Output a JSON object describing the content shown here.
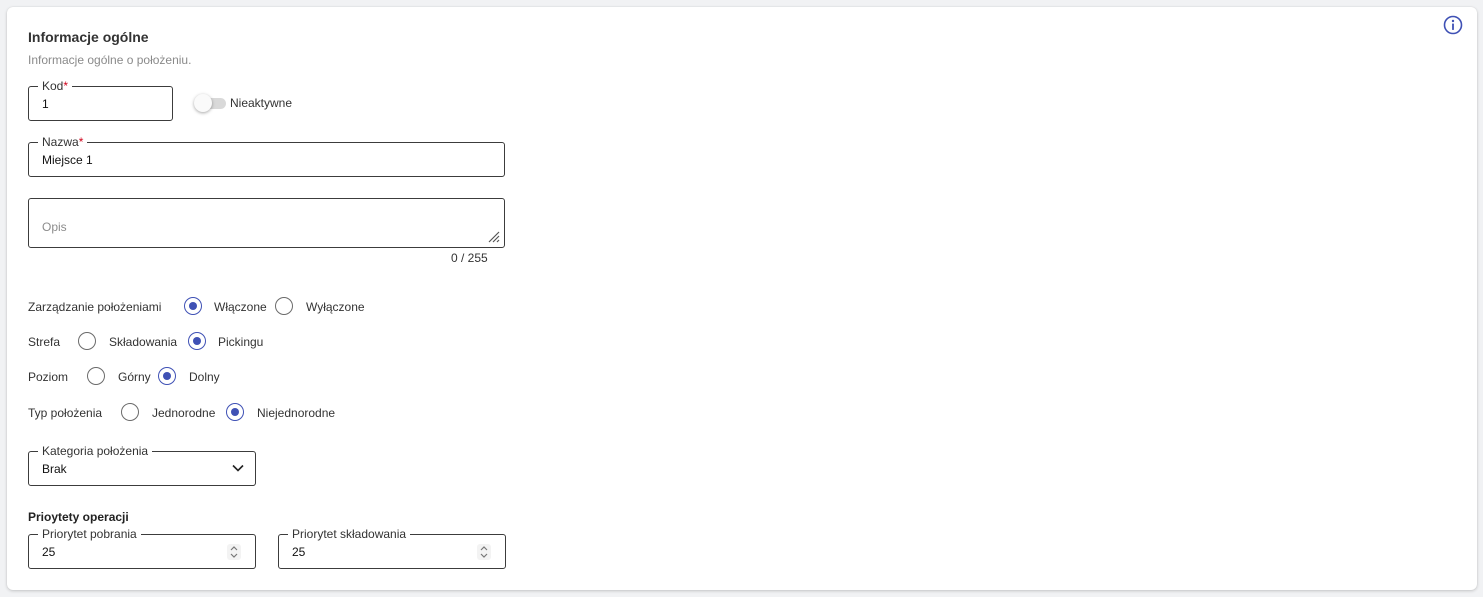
{
  "section": {
    "title": "Informacje ogólne",
    "subtitle": "Informacje ogólne o położeniu."
  },
  "fields": {
    "kod": {
      "label": "Kod",
      "required_mark": "*",
      "value": "1"
    },
    "nazwa": {
      "label": "Nazwa",
      "required_mark": "*",
      "value": "Miejsce 1"
    },
    "opis": {
      "placeholder": "Opis",
      "value": "",
      "counter": "0 / 255"
    },
    "kategoria": {
      "label": "Kategoria położenia",
      "value": "Brak"
    },
    "priorytet_pobrania": {
      "label": "Priorytet pobrania",
      "value": "25"
    },
    "priorytet_skladowania": {
      "label": "Priorytet składowania",
      "value": "25"
    }
  },
  "toggle": {
    "label": "Nieaktywne",
    "checked": false
  },
  "radio_groups": {
    "zarzadzanie": {
      "label": "Zarządzanie położeniami",
      "options": [
        "Włączone",
        "Wyłączone"
      ],
      "selected": "Włączone"
    },
    "strefa": {
      "label": "Strefa",
      "options": [
        "Składowania",
        "Pickingu"
      ],
      "selected": "Pickingu"
    },
    "poziom": {
      "label": "Poziom",
      "options": [
        "Górny",
        "Dolny"
      ],
      "selected": "Dolny"
    },
    "typ": {
      "label": "Typ położenia",
      "options": [
        "Jednorodne",
        "Niejednorodne"
      ],
      "selected": "Niejednorodne"
    }
  },
  "priorities": {
    "title": "Prioytety operacji"
  },
  "icons": {
    "info": "info-circle-icon",
    "resize": "resize-handle-icon",
    "dropdown": "chevron-down-icon",
    "spinner": "spinner-arrows-icon"
  },
  "colors": {
    "accent": "#3f51b5",
    "required": "#d0021b",
    "border": "#3c3c3c",
    "muted_text": "#8a8a8a"
  }
}
